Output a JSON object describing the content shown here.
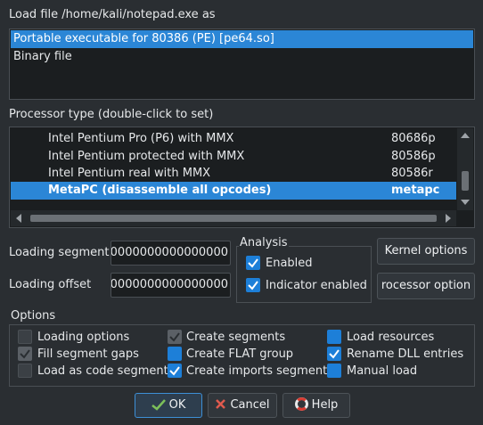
{
  "dialog": {
    "load_file_label": "Load file /home/kali/notepad.exe as",
    "file_types": [
      {
        "label": "Portable executable for 80386 (PE) [pe64.so]",
        "selected": true
      },
      {
        "label": "Binary file",
        "selected": false
      }
    ],
    "processor_type_label": "Processor type (double-click to set)",
    "processors": [
      {
        "name": "Intel Pentium Pro (P6) with MMX",
        "code": "80686p",
        "selected": false
      },
      {
        "name": "Intel Pentium protected with MMX",
        "code": "80586p",
        "selected": false
      },
      {
        "name": "Intel Pentium real with MMX",
        "code": "80586r",
        "selected": false
      },
      {
        "name": "MetaPC (disassemble all opcodes)",
        "code": "metapc",
        "selected": true
      }
    ],
    "loading_segment_label": "Loading segment",
    "loading_segment_value": "0000000000000000",
    "loading_offset_label": "Loading offset",
    "loading_offset_value": "0000000000000000",
    "analysis": {
      "title": "Analysis",
      "enabled_label": "Enabled",
      "enabled_checked": true,
      "indicator_label": "Indicator enabled",
      "indicator_checked": true
    },
    "kernel_options_label": "Kernel options",
    "processor_options_label": "rocessor option",
    "options_title": "Options",
    "options": {
      "loading_options": {
        "label": "Loading options",
        "state": "unchecked"
      },
      "fill_segment_gaps": {
        "label": "Fill segment gaps",
        "state": "checked-disabled"
      },
      "load_as_code_segment": {
        "label": "Load as code segment",
        "state": "unchecked"
      },
      "create_segments": {
        "label": "Create segments",
        "state": "checked-disabled"
      },
      "create_flat_group": {
        "label": "Create FLAT group",
        "state": "unchecked-blue"
      },
      "create_imports_segment": {
        "label": "Create imports segment",
        "state": "checked"
      },
      "load_resources": {
        "label": "Load resources",
        "state": "unchecked-blue"
      },
      "rename_dll_entries": {
        "label": "Rename DLL entries",
        "state": "checked"
      },
      "manual_load": {
        "label": "Manual load",
        "state": "unchecked-blue"
      }
    },
    "buttons": {
      "ok": "OK",
      "cancel": "Cancel",
      "help": "Help"
    },
    "colors": {
      "selection": "#2b86d6",
      "checkbox_checked": "#1d7fd8",
      "background": "#2a2e32"
    }
  }
}
